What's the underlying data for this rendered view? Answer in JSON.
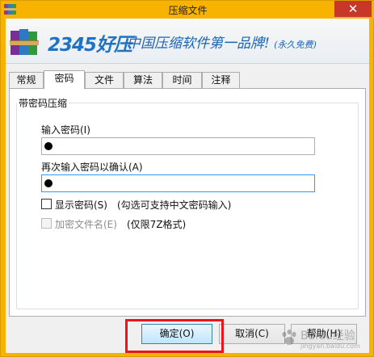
{
  "window": {
    "title": "压缩文件",
    "close_glyph": "✕",
    "accent_color": "#f8b200",
    "close_color": "#c7372a"
  },
  "banner": {
    "brand": "2345好压",
    "slogan": "中国压缩软件第一品牌!",
    "slogan_note": "(永久免费)"
  },
  "tabs": [
    {
      "label": "常规",
      "active": false
    },
    {
      "label": "密码",
      "active": true
    },
    {
      "label": "文件",
      "active": false
    },
    {
      "label": "算法",
      "active": false
    },
    {
      "label": "时间",
      "active": false
    },
    {
      "label": "注释",
      "active": false
    }
  ],
  "password_group": {
    "title": "带密码压缩",
    "enter_label": "输入密码(I)",
    "reenter_label": "再次输入密码以确认(A)",
    "show_password_label": "显示密码(S)",
    "show_password_note": "(勾选可支持中文密码输入)",
    "show_password_checked": false,
    "encrypt_names_label": "加密文件名(E)",
    "encrypt_names_note": "(仅限7Z格式)",
    "encrypt_names_checked": false,
    "encrypt_names_enabled": false
  },
  "buttons": {
    "ok": "确定(O)",
    "cancel": "取消(C)",
    "help": "帮助(H)"
  },
  "watermark": {
    "text": "Baidu经验",
    "url": "jingyan.baidu.com"
  }
}
